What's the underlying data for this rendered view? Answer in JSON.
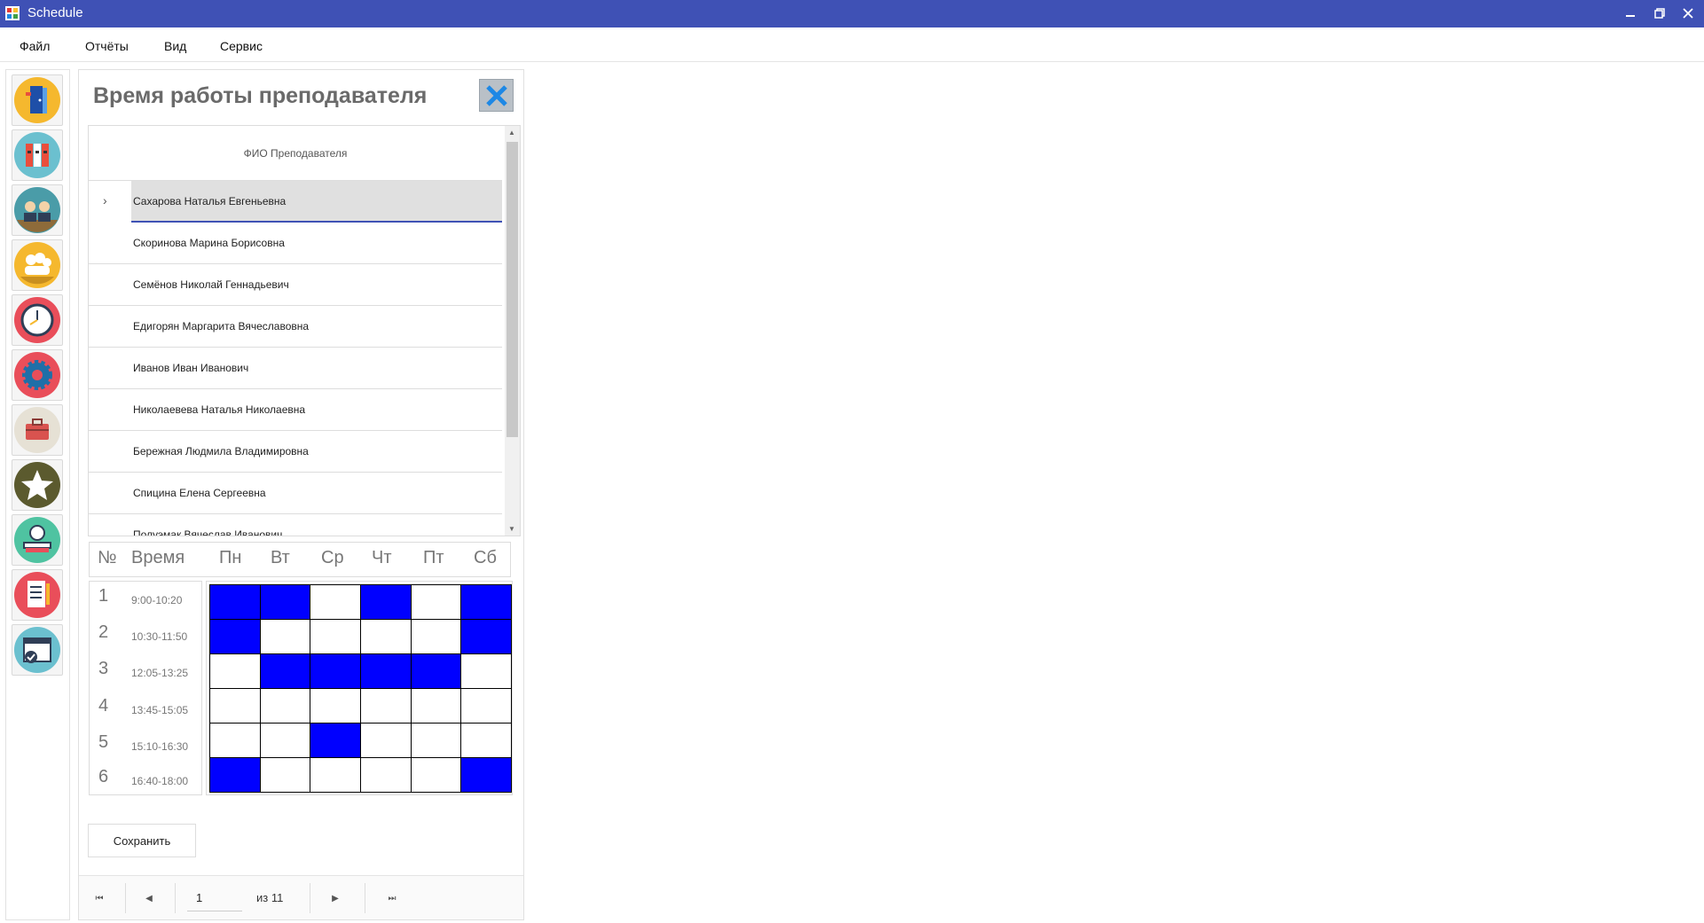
{
  "window": {
    "title": "Schedule"
  },
  "menu": [
    "Файл",
    "Отчёты",
    "Вид",
    "Сервис"
  ],
  "sidebar": {
    "icons": [
      "door-icon",
      "folders-icon",
      "teachers-icon",
      "group-icon",
      "clock-icon",
      "settings-icon",
      "briefcase-icon",
      "star-icon",
      "student-icon",
      "checklist-icon",
      "calendar-icon"
    ]
  },
  "panel": {
    "title": "Время работы преподавателя",
    "grid": {
      "header": "ФИО Преподавателя",
      "rows": [
        "Сахарова Наталья Евгеньевна",
        "Скоринова Марина Борисовна",
        "Семёнов Николай Геннадьевич",
        "Едигорян Маргарита Вячеславовна",
        "Иванов Иван Иванович",
        "Николаевева Наталья Николаевна",
        "Бережная Людмила Владимировна",
        "Спицина Елена Сергеевна",
        "Полуэмак Вячеслав Иванович"
      ],
      "selected_index": 0
    },
    "schedule": {
      "num_label": "№",
      "time_label": "Время",
      "days": [
        "Пн",
        "Вт",
        "Ср",
        "Чт",
        "Пт",
        "Сб"
      ],
      "slots": [
        {
          "num": "1",
          "time": "9:00-10:20"
        },
        {
          "num": "2",
          "time": "10:30-11:50"
        },
        {
          "num": "3",
          "time": "12:05-13:25"
        },
        {
          "num": "4",
          "time": "13:45-15:05"
        },
        {
          "num": "5",
          "time": "15:10-16:30"
        },
        {
          "num": "6",
          "time": "16:40-18:00"
        }
      ],
      "busy": [
        [
          1,
          1,
          0,
          1,
          0,
          1
        ],
        [
          1,
          0,
          0,
          0,
          0,
          1
        ],
        [
          0,
          1,
          1,
          1,
          1,
          0
        ],
        [
          0,
          0,
          0,
          0,
          0,
          0
        ],
        [
          0,
          0,
          1,
          0,
          0,
          0
        ],
        [
          1,
          0,
          0,
          0,
          0,
          1
        ]
      ],
      "busy_color": "#0000ff"
    },
    "save_label": "Сохранить",
    "navigator": {
      "current": "1",
      "of_label": "из 11"
    }
  },
  "colors": {
    "titlebar": "#3f51b5",
    "selection_line": "#3f51b5"
  }
}
